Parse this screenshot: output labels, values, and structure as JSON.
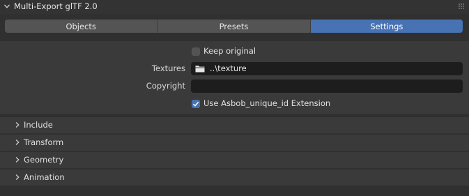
{
  "panel": {
    "title": "Multi-Export glTF 2.0",
    "expanded": true
  },
  "tabs": [
    {
      "label": "Objects",
      "active": false
    },
    {
      "label": "Presets",
      "active": false
    },
    {
      "label": "Settings",
      "active": true
    }
  ],
  "settings": {
    "keep_original": {
      "label": "Keep original",
      "checked": false
    },
    "textures": {
      "label": "Textures",
      "value": "..\\texture",
      "icon": "folder-icon"
    },
    "copyright": {
      "label": "Copyright",
      "value": ""
    },
    "use_extension": {
      "label": "Use Asbob_unique_id Extension",
      "checked": true
    }
  },
  "subpanels": [
    {
      "label": "Include"
    },
    {
      "label": "Transform"
    },
    {
      "label": "Geometry"
    },
    {
      "label": "Animation"
    }
  ],
  "colors": {
    "accent": "#4772b3",
    "background": "#303030",
    "panel": "#3a3a3a",
    "field": "#1d1d1d"
  }
}
